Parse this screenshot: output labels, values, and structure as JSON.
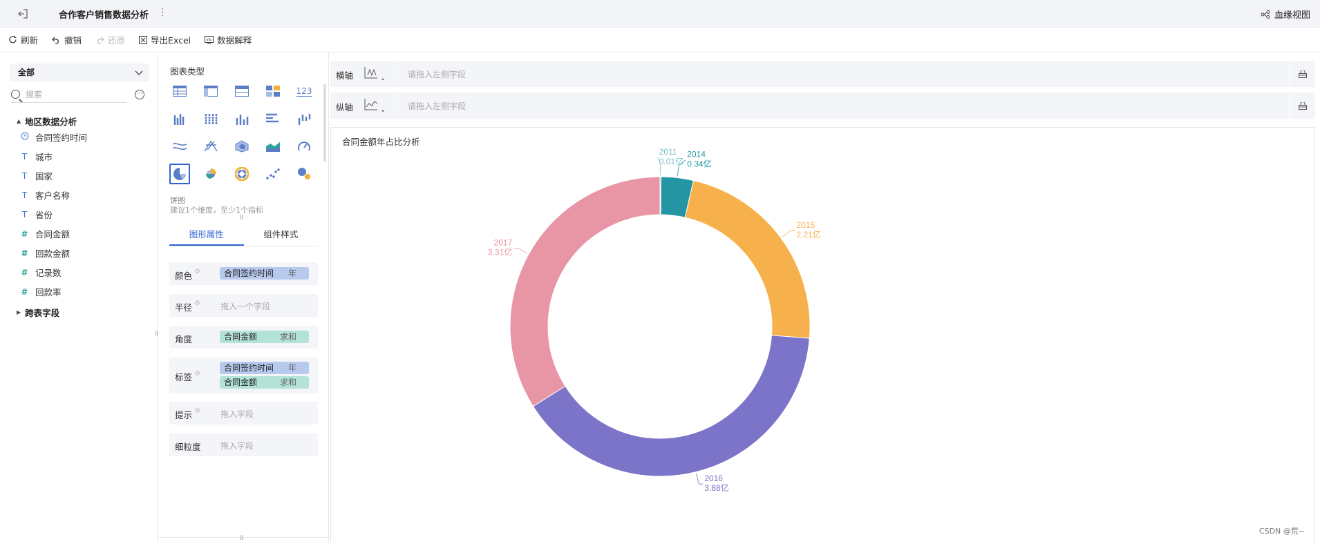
{
  "topbar": {
    "title": "合作客户销售数据分析",
    "lineage_label": "血缘视图"
  },
  "toolbar": {
    "refresh": "刷新",
    "undo": "撤销",
    "redo": "还原",
    "export": "导出Excel",
    "explain": "数据解释"
  },
  "left": {
    "scope": "全部",
    "search_placeholder": "搜索",
    "group": "地区数据分析",
    "fields": [
      {
        "label": "合同签约时间",
        "icon": "clock-icon"
      },
      {
        "label": "城市",
        "icon": "text-icon"
      },
      {
        "label": "国家",
        "icon": "text-icon"
      },
      {
        "label": "客户名称",
        "icon": "text-icon"
      },
      {
        "label": "省份",
        "icon": "text-icon"
      },
      {
        "label": "合同金额",
        "icon": "number-icon"
      },
      {
        "label": "回款金额",
        "icon": "number-icon"
      },
      {
        "label": "记录数",
        "icon": "number-icon"
      },
      {
        "label": "回款率",
        "icon": "number-icon"
      }
    ],
    "cross_table": "跨表字段"
  },
  "mid": {
    "chart_type_label": "图表类型",
    "selected_type": "饼图",
    "hint": "建议1个维度，至少1个指标",
    "tabs": [
      "图形属性",
      "组件样式"
    ],
    "props": {
      "color": {
        "label": "颜色",
        "pill": "合同签约时间",
        "agg": "年"
      },
      "radius": {
        "label": "半径",
        "placeholder": "拖入一个字段"
      },
      "angle": {
        "label": "角度",
        "pill": "合同金额",
        "agg": "求和"
      },
      "label": {
        "label": "标签",
        "pill1": "合同签约时间",
        "agg1": "年",
        "pill2": "合同金额",
        "agg2": "求和"
      },
      "tooltip": {
        "label": "提示",
        "placeholder": "拖入字段"
      },
      "granularity": {
        "label": "细粒度",
        "placeholder": "拖入字段"
      }
    },
    "chart_type_icon_123": "123"
  },
  "axes": {
    "x_label": "横轴",
    "y_label": "纵轴",
    "placeholder": "请拖入左侧字段"
  },
  "chart": {
    "title": "合同金额年占比分析",
    "watermark": "CSDN @荒~"
  },
  "colors": {
    "accent": "#2e63d3",
    "2011": "#7fbfc7",
    "2014": "#2496a3",
    "2015": "#f7b14c",
    "2016": "#7b74c8",
    "2017": "#e895a6"
  },
  "chart_data": {
    "type": "pie",
    "title": "合同金额年占比分析",
    "unit": "亿",
    "categories": [
      "2011",
      "2014",
      "2015",
      "2016",
      "2017"
    ],
    "values": [
      0.01,
      0.34,
      2.21,
      3.88,
      3.31
    ],
    "labels": [
      "0.01亿",
      "0.34亿",
      "2.21亿",
      "3.88亿",
      "3.31亿"
    ]
  }
}
